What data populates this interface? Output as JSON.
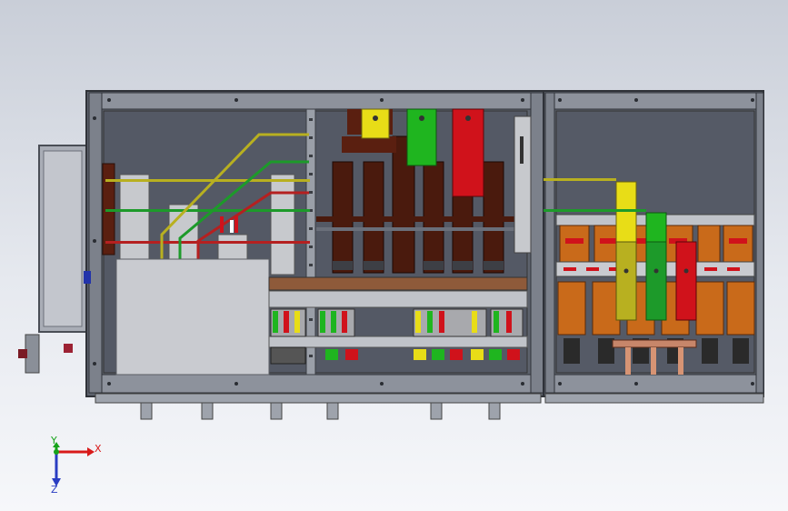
{
  "triad": {
    "x_label": "X",
    "y_label": "Y",
    "z_label": "Z",
    "x_color": "#d81a1a",
    "y_color": "#16a31a",
    "z_color": "#2a3dc2"
  },
  "colors": {
    "frame": "#6a6f7a",
    "frame_dark": "#3f434b",
    "panel_bg": "#5b606b",
    "plate": "#c9cbd0",
    "busbar_yellow": "#e8dd17",
    "busbar_green": "#1fb51f",
    "busbar_red": "#d0121b",
    "copper": "#5a1f10",
    "breaker_orange": "#c96a1a",
    "pipe_yellow": "#b8b020",
    "pipe_green": "#1d9a2a",
    "pipe_red": "#b52020"
  }
}
